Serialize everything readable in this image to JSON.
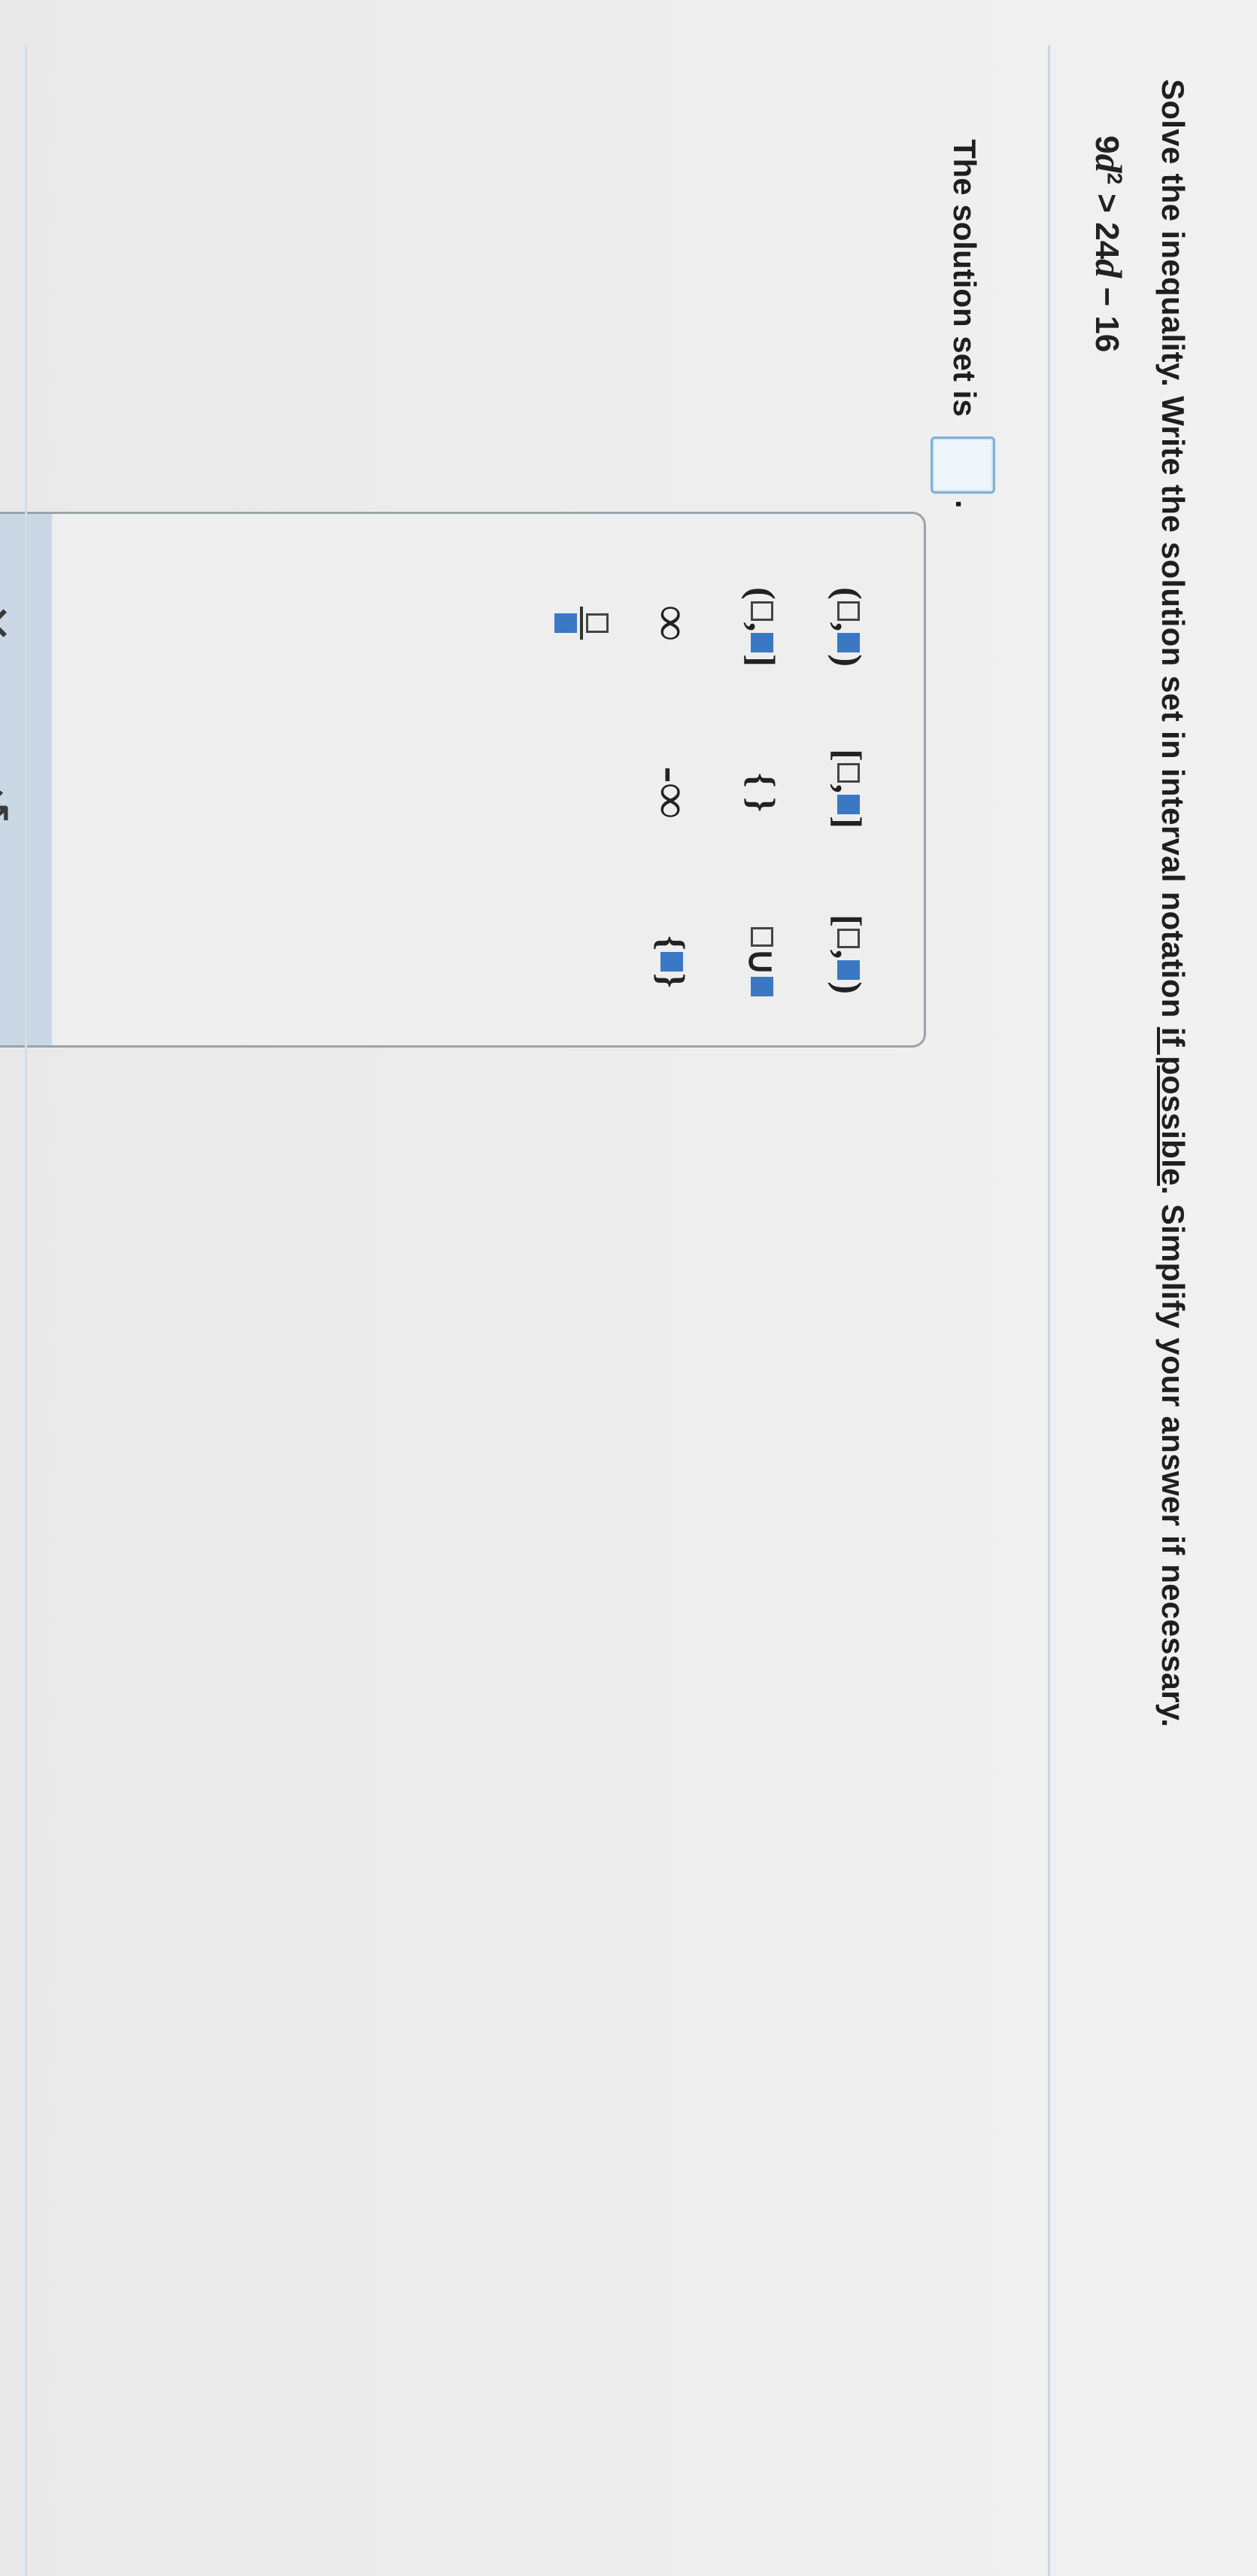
{
  "question": {
    "instruction_part1": "Solve the inequality. Write the solution set in interval notation ",
    "instruction_link": "if possible",
    "instruction_part2": ". Simplify your answer if necessary.",
    "equation_lhs_coef": "9",
    "equation_lhs_var": "d",
    "equation_lhs_exp": "2",
    "equation_op": " > ",
    "equation_rhs_coef": "24",
    "equation_rhs_var": "d",
    "equation_rhs_const": " − 16"
  },
  "answer": {
    "prompt": "The solution set is",
    "value": "",
    "trailing": "."
  },
  "palette": {
    "buttons": [
      {
        "name": "open-open-interval",
        "left": "(",
        "right": ")"
      },
      {
        "name": "closed-closed-interval",
        "left": "[",
        "right": "]"
      },
      {
        "name": "closed-open-interval",
        "left": "[",
        "right": ")"
      },
      {
        "name": "open-closed-interval",
        "left": "(",
        "right": "]"
      },
      {
        "name": "empty-set",
        "label": "{ }"
      },
      {
        "name": "union",
        "label": "∪"
      },
      {
        "name": "infinity",
        "label": "∞"
      },
      {
        "name": "negative-infinity",
        "label": "-∞"
      },
      {
        "name": "set-braces",
        "label": "{ }"
      },
      {
        "name": "fraction",
        "label": ""
      }
    ],
    "clear_label": "✕",
    "undo_label": "↺"
  }
}
